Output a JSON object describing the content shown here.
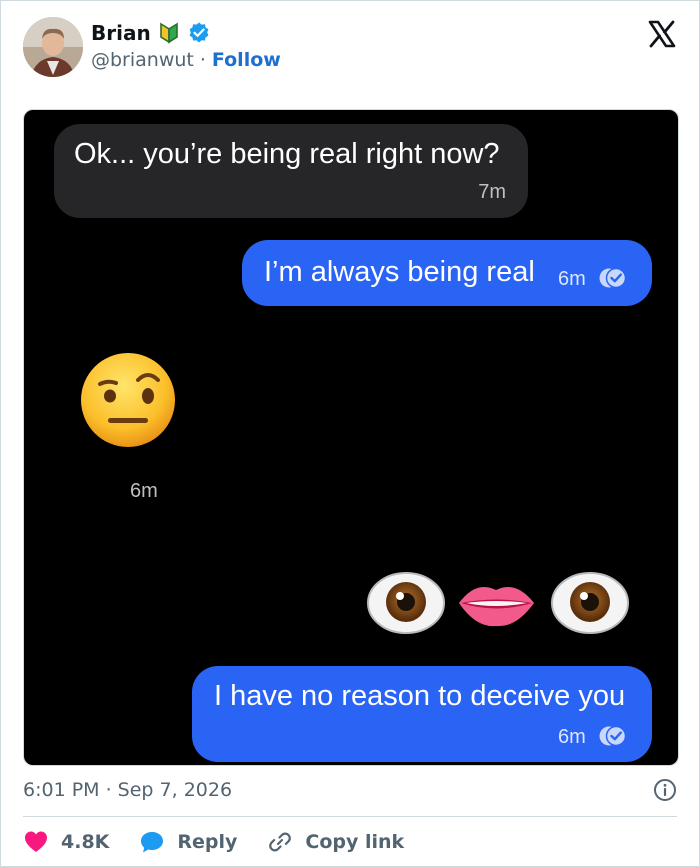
{
  "tweet": {
    "author": {
      "display_name": "Brian",
      "handle": "@brianwut",
      "follow_label": "Follow",
      "verified": true,
      "badge_icon": "beginner-symbol-icon"
    },
    "platform_icon": "x-logo-icon",
    "timestamp": "6:01 PM · Sep 7, 2026",
    "actions": {
      "likes": "4.8K",
      "reply_label": "Reply",
      "copy_label": "Copy link"
    }
  },
  "chat": {
    "messages": [
      {
        "side": "incoming",
        "text": "Ok... you’re being real right now?",
        "time": "7m"
      },
      {
        "side": "outgoing",
        "text": "I’m always being real",
        "time": "6m",
        "status_icon": "read-receipt-icon"
      },
      {
        "side": "incoming",
        "emoji": "face-with-raised-eyebrow",
        "time": "6m"
      },
      {
        "side": "outgoing",
        "emoji": "eye-lips-eye"
      },
      {
        "side": "outgoing",
        "text": "I have no reason to deceive you",
        "time": "6m",
        "status_icon": "read-receipt-icon"
      }
    ]
  },
  "colors": {
    "outgoing_bubble": "#2a64f5",
    "incoming_bubble": "#262628",
    "link": "#1d6fd0",
    "like": "#f91880",
    "reply": "#1d9bf0"
  }
}
